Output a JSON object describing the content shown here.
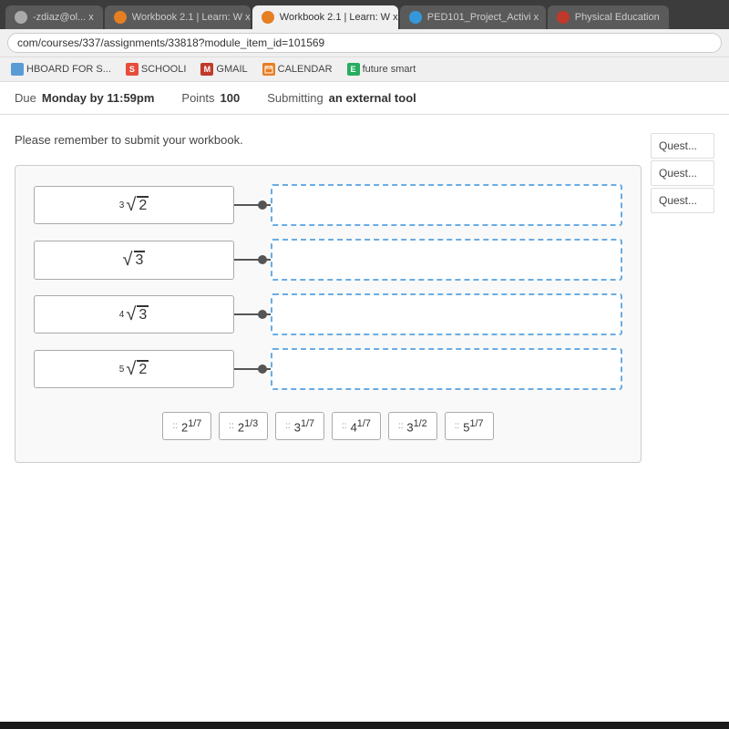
{
  "browser": {
    "tabs": [
      {
        "id": "tab1",
        "label": "-zdiaz@ol... x",
        "icon_color": "#aaa",
        "active": false
      },
      {
        "id": "tab2",
        "label": "Workbook 2.1 | Learn: W x",
        "icon_color": "#e67e22",
        "active": false
      },
      {
        "id": "tab3",
        "label": "Workbook 2.1 | Learn: W x",
        "icon_color": "#e67e22",
        "active": true
      },
      {
        "id": "tab4",
        "label": "PED101_Project_Activi x",
        "icon_color": "#3498db",
        "active": false
      },
      {
        "id": "tab5",
        "label": "Physical Education",
        "icon_color": "#c0392b",
        "active": false
      }
    ],
    "address": "com/courses/337/assignments/33818?module_item_id=101569",
    "bookmarks": [
      {
        "label": "HBOARD FOR S...",
        "icon_bg": "#5b9bd5",
        "icon_text": ""
      },
      {
        "label": "SCHOOLI",
        "icon_bg": "#e74c3c",
        "icon_text": "S"
      },
      {
        "label": "GMAIL",
        "icon_bg": "#c0392b",
        "icon_text": "M"
      },
      {
        "label": "CALENDAR",
        "icon_bg": "#e67e22",
        "icon_text": ""
      },
      {
        "label": "future smart",
        "icon_bg": "#27ae60",
        "icon_text": "E"
      }
    ]
  },
  "assignment": {
    "due_label": "Due",
    "due_value": "Monday by 11:59pm",
    "points_label": "Points",
    "points_value": "100",
    "submitting_label": "Submitting",
    "submitting_value": "an external tool"
  },
  "page": {
    "notice": "Please remember to submit your workbook.",
    "matching": {
      "rows": [
        {
          "left": "∛2",
          "left_raw": "cube_root_2"
        },
        {
          "left": "√3",
          "left_raw": "sqrt_3"
        },
        {
          "left": "⁴√3",
          "left_raw": "fourth_root_3"
        },
        {
          "left": "⁵√2",
          "left_raw": "fifth_root_2"
        }
      ],
      "answer_bank": [
        {
          "label": "2^(1/7)"
        },
        {
          "label": "2^(1/3)"
        },
        {
          "label": "3^(1/7)"
        },
        {
          "label": "4^(1/7)"
        },
        {
          "label": "3^(1/2)"
        },
        {
          "label": "5^(1/7)"
        }
      ]
    },
    "sidebar": {
      "items": [
        {
          "label": "Quest..."
        },
        {
          "label": "Quest..."
        },
        {
          "label": "Quest..."
        }
      ]
    }
  }
}
